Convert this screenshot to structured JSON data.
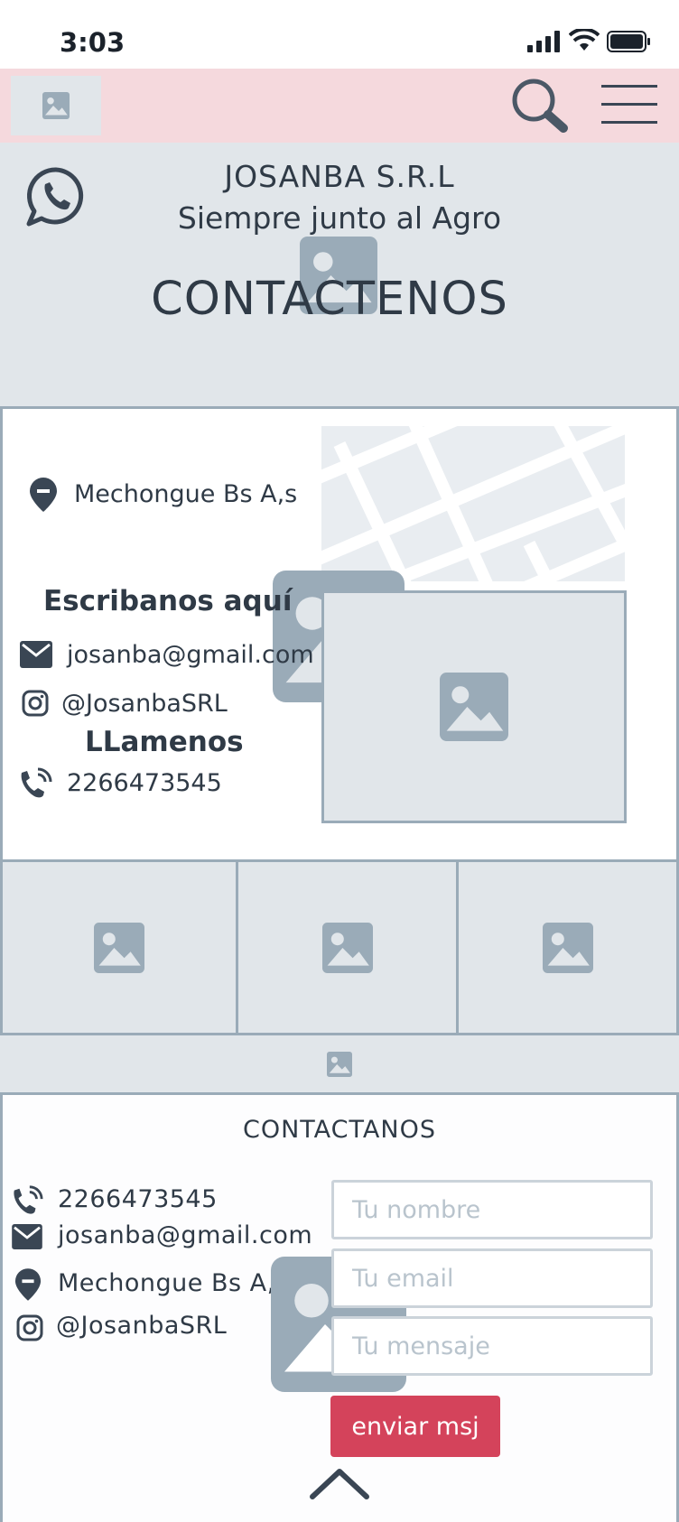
{
  "status_bar": {
    "time": "3:03"
  },
  "navbar": {
    "logo_icon": "image-placeholder-icon",
    "search_icon": "search-icon",
    "menu_icon": "hamburger-menu-icon"
  },
  "hero": {
    "whatsapp_icon": "whatsapp-icon",
    "brand_name": "JOSANBA S.R.L",
    "tagline": "Siempre junto al Agro",
    "title": "CONTACTENOS"
  },
  "info": {
    "location": "Mechongue Bs A,s",
    "write_heading": "Escribanos aquí",
    "email": "josanba@gmail.com",
    "instagram": "@JosanbaSRL",
    "call_heading": "LLamenos",
    "phone": "2266473545"
  },
  "footer": {
    "title": "CONTACTANOS",
    "phone": "2266473545",
    "email": "josanba@gmail.com",
    "location": "Mechongue Bs A,s",
    "instagram": "@JosanbaSRL",
    "form": {
      "name_placeholder": "Tu nombre",
      "email_placeholder": "Tu email",
      "message_placeholder": "Tu mensaje",
      "submit_label": "enviar msj"
    },
    "scroll_top_icon": "chevron-up-icon"
  },
  "colors": {
    "navbar_bg": "#f5d9dd",
    "placeholder_bg": "#e1e6ea",
    "border": "#9aabb8",
    "text": "#2f3a46",
    "button": "#d4435b"
  }
}
